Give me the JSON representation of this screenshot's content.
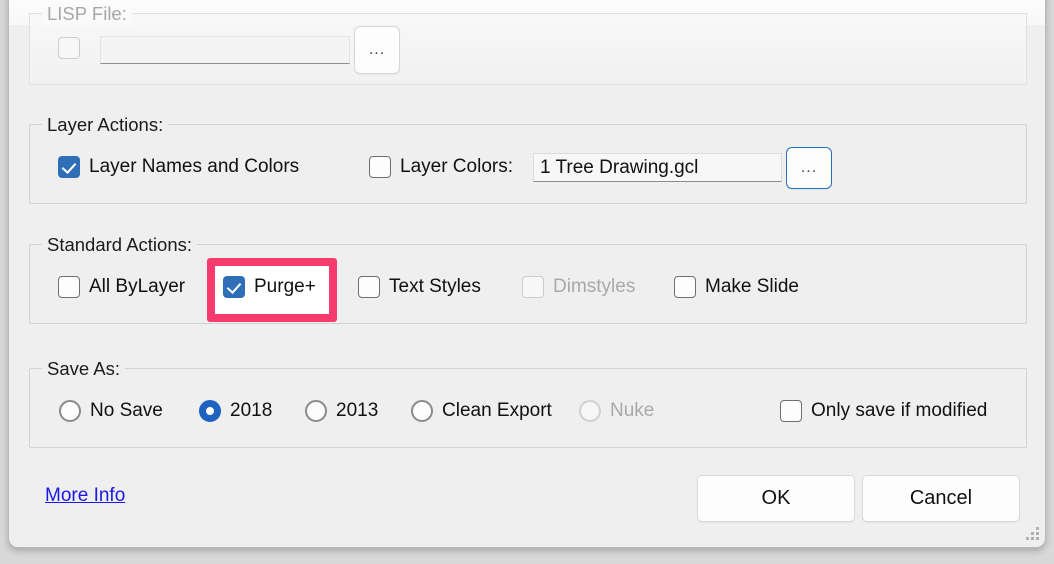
{
  "dialog": {
    "groups": {
      "lisp": {
        "label": "LISP File:",
        "enabled": false,
        "checkbox_label": "",
        "path_value": "",
        "path_placeholder": "",
        "browse_label": "..."
      },
      "layer_actions": {
        "label": "Layer Actions:",
        "items": [
          {
            "label": "Layer Names and Colors",
            "checked": true,
            "enabled": true
          },
          {
            "label": "Layer Colors:",
            "checked": false,
            "enabled": true
          }
        ],
        "color_file_value": "1 Tree Drawing.gcl",
        "browse_label": "..."
      },
      "standard_actions": {
        "label": "Standard Actions:",
        "items": [
          {
            "label": "All ByLayer",
            "checked": false,
            "enabled": true
          },
          {
            "label": "Purge+",
            "checked": true,
            "enabled": true
          },
          {
            "label": "Text Styles",
            "checked": false,
            "enabled": true
          },
          {
            "label": "Dimstyles",
            "checked": false,
            "enabled": false
          },
          {
            "label": "Make Slide",
            "checked": false,
            "enabled": true
          }
        ]
      },
      "save_as": {
        "label": "Save As:",
        "options": [
          {
            "label": "No Save",
            "selected": false,
            "enabled": true
          },
          {
            "label": "2018",
            "selected": true,
            "enabled": true
          },
          {
            "label": "2013",
            "selected": false,
            "enabled": true
          },
          {
            "label": "Clean Export",
            "selected": false,
            "enabled": true
          },
          {
            "label": "Nuke",
            "selected": false,
            "enabled": false
          }
        ],
        "only_save_if_modified": {
          "label": "Only save if modified",
          "checked": false,
          "enabled": true
        }
      }
    },
    "footer": {
      "more_info_label": "More Info",
      "ok_label": "OK",
      "cancel_label": "Cancel"
    },
    "annotation": {
      "target": "Purge+",
      "color": "#f63b6e"
    },
    "colors": {
      "accent_blue": "#2f6fb8",
      "radio_blue": "#1f63c0",
      "link_blue": "#1a1ae6",
      "window_bg": "#efefef",
      "highlight_pink": "#f63b6e"
    }
  }
}
